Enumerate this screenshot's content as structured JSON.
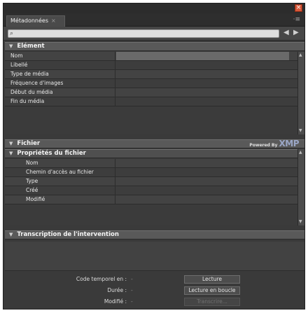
{
  "panel": {
    "tab_label": "Métadonnées",
    "tab_close": "×",
    "menu_icon": "·≡",
    "close_symbol": "×"
  },
  "search": {
    "icon": "⌕",
    "placeholder": "",
    "value": "",
    "prev_symbol": "◀",
    "next_symbol": "▶"
  },
  "element_section": {
    "title": "Elément",
    "rows": [
      {
        "label": "Nom"
      },
      {
        "label": "Libellé"
      },
      {
        "label": "Type de média"
      },
      {
        "label": "Fréquence d'images"
      },
      {
        "label": "Début du média"
      },
      {
        "label": "Fin du média"
      }
    ]
  },
  "fichier_section": {
    "title": "Fichier",
    "powered_by": "Powered By",
    "xmp": "XMP",
    "subsection_title": "Propriétés du fichier",
    "rows": [
      {
        "label": "Nom"
      },
      {
        "label": "Chemin d'accès au fichier"
      },
      {
        "label": "Type"
      },
      {
        "label": "Créé"
      },
      {
        "label": "Modifié"
      }
    ]
  },
  "transcription_section": {
    "title": "Transcription de l'intervention"
  },
  "bottom": {
    "timecode_label": "Code temporel en :",
    "timecode_value": "-",
    "duration_label": "Durée :",
    "duration_value": "-",
    "modified_label": "Modifié :",
    "modified_value": "-",
    "play_button": "Lecture",
    "loop_button": "Lecture en boucle",
    "transcribe_button": "Transcrire..."
  },
  "colors": {
    "panel_bg": "#3a3a3a",
    "section_header": "#595959",
    "close_button": "#d9593a",
    "xmp_logo": "#9aa6c6"
  }
}
